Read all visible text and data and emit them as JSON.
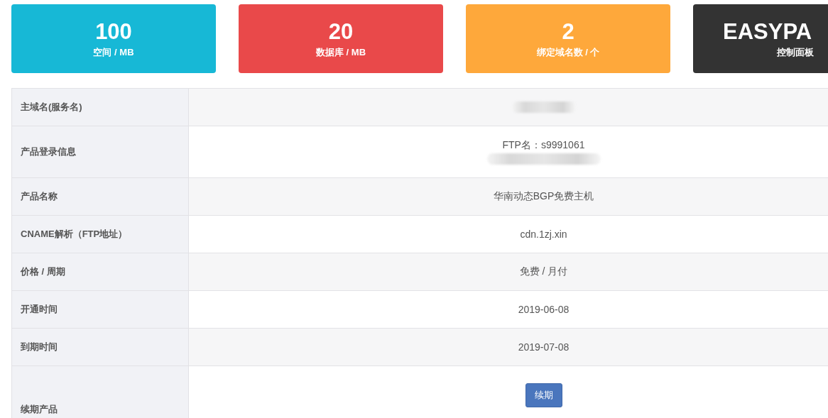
{
  "stat_cards": [
    {
      "value": "100",
      "label": "空间 / MB",
      "color": "#17b8d6"
    },
    {
      "value": "20",
      "label": "数据库 / MB",
      "color": "#e9494a"
    },
    {
      "value": "2",
      "label": "绑定域名数 / 个",
      "color": "#fea83b"
    },
    {
      "value": "EASYPA",
      "label": "控制面板",
      "color": "#333333"
    }
  ],
  "table": {
    "rows": [
      {
        "label": "主域名(服务名)",
        "content": [
          {
            "kind": "redacted"
          }
        ]
      },
      {
        "label": "产品登录信息",
        "content": [
          {
            "kind": "text",
            "text": "FTP名：s9991061"
          },
          {
            "kind": "redacted"
          }
        ]
      },
      {
        "label": "产品名称",
        "content": [
          {
            "kind": "text",
            "text": "华南动态BGP免费主机"
          }
        ]
      },
      {
        "label": "CNAME解析（FTP地址）",
        "content": [
          {
            "kind": "text",
            "text": "cdn.1zj.xin"
          }
        ]
      },
      {
        "label": "价格 / 周期",
        "content": [
          {
            "kind": "text",
            "text": "免费 / 月付"
          }
        ]
      },
      {
        "label": "开通时间",
        "content": [
          {
            "kind": "text",
            "text": "2019-06-08"
          }
        ]
      },
      {
        "label": "到期时间",
        "content": [
          {
            "kind": "text",
            "text": "2019-07-08"
          }
        ]
      },
      {
        "label": "续期产品",
        "content": [
          {
            "kind": "button",
            "text": "续期"
          }
        ]
      }
    ]
  }
}
